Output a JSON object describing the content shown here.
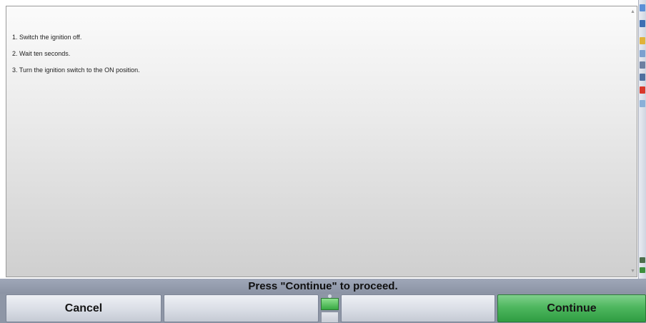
{
  "instructions": {
    "steps": [
      "1. Switch the ignition off.",
      "2. Wait ten seconds.",
      "3. Turn the ignition switch to the ON position."
    ]
  },
  "status": {
    "message": "Press \"Continue\" to proceed."
  },
  "buttons": {
    "cancel_label": "Cancel",
    "f2_label": "",
    "f3_label": "",
    "continue_label": "Continue"
  },
  "colors": {
    "continue_button": "#4fb75f",
    "status_bar": "#9aa2b3",
    "button_face": "#d9dde5"
  },
  "icons": {
    "scroll_up": "scroll-up-arrow-icon",
    "scroll_down": "scroll-down-arrow-icon",
    "indicator": "connection-status-icon"
  }
}
